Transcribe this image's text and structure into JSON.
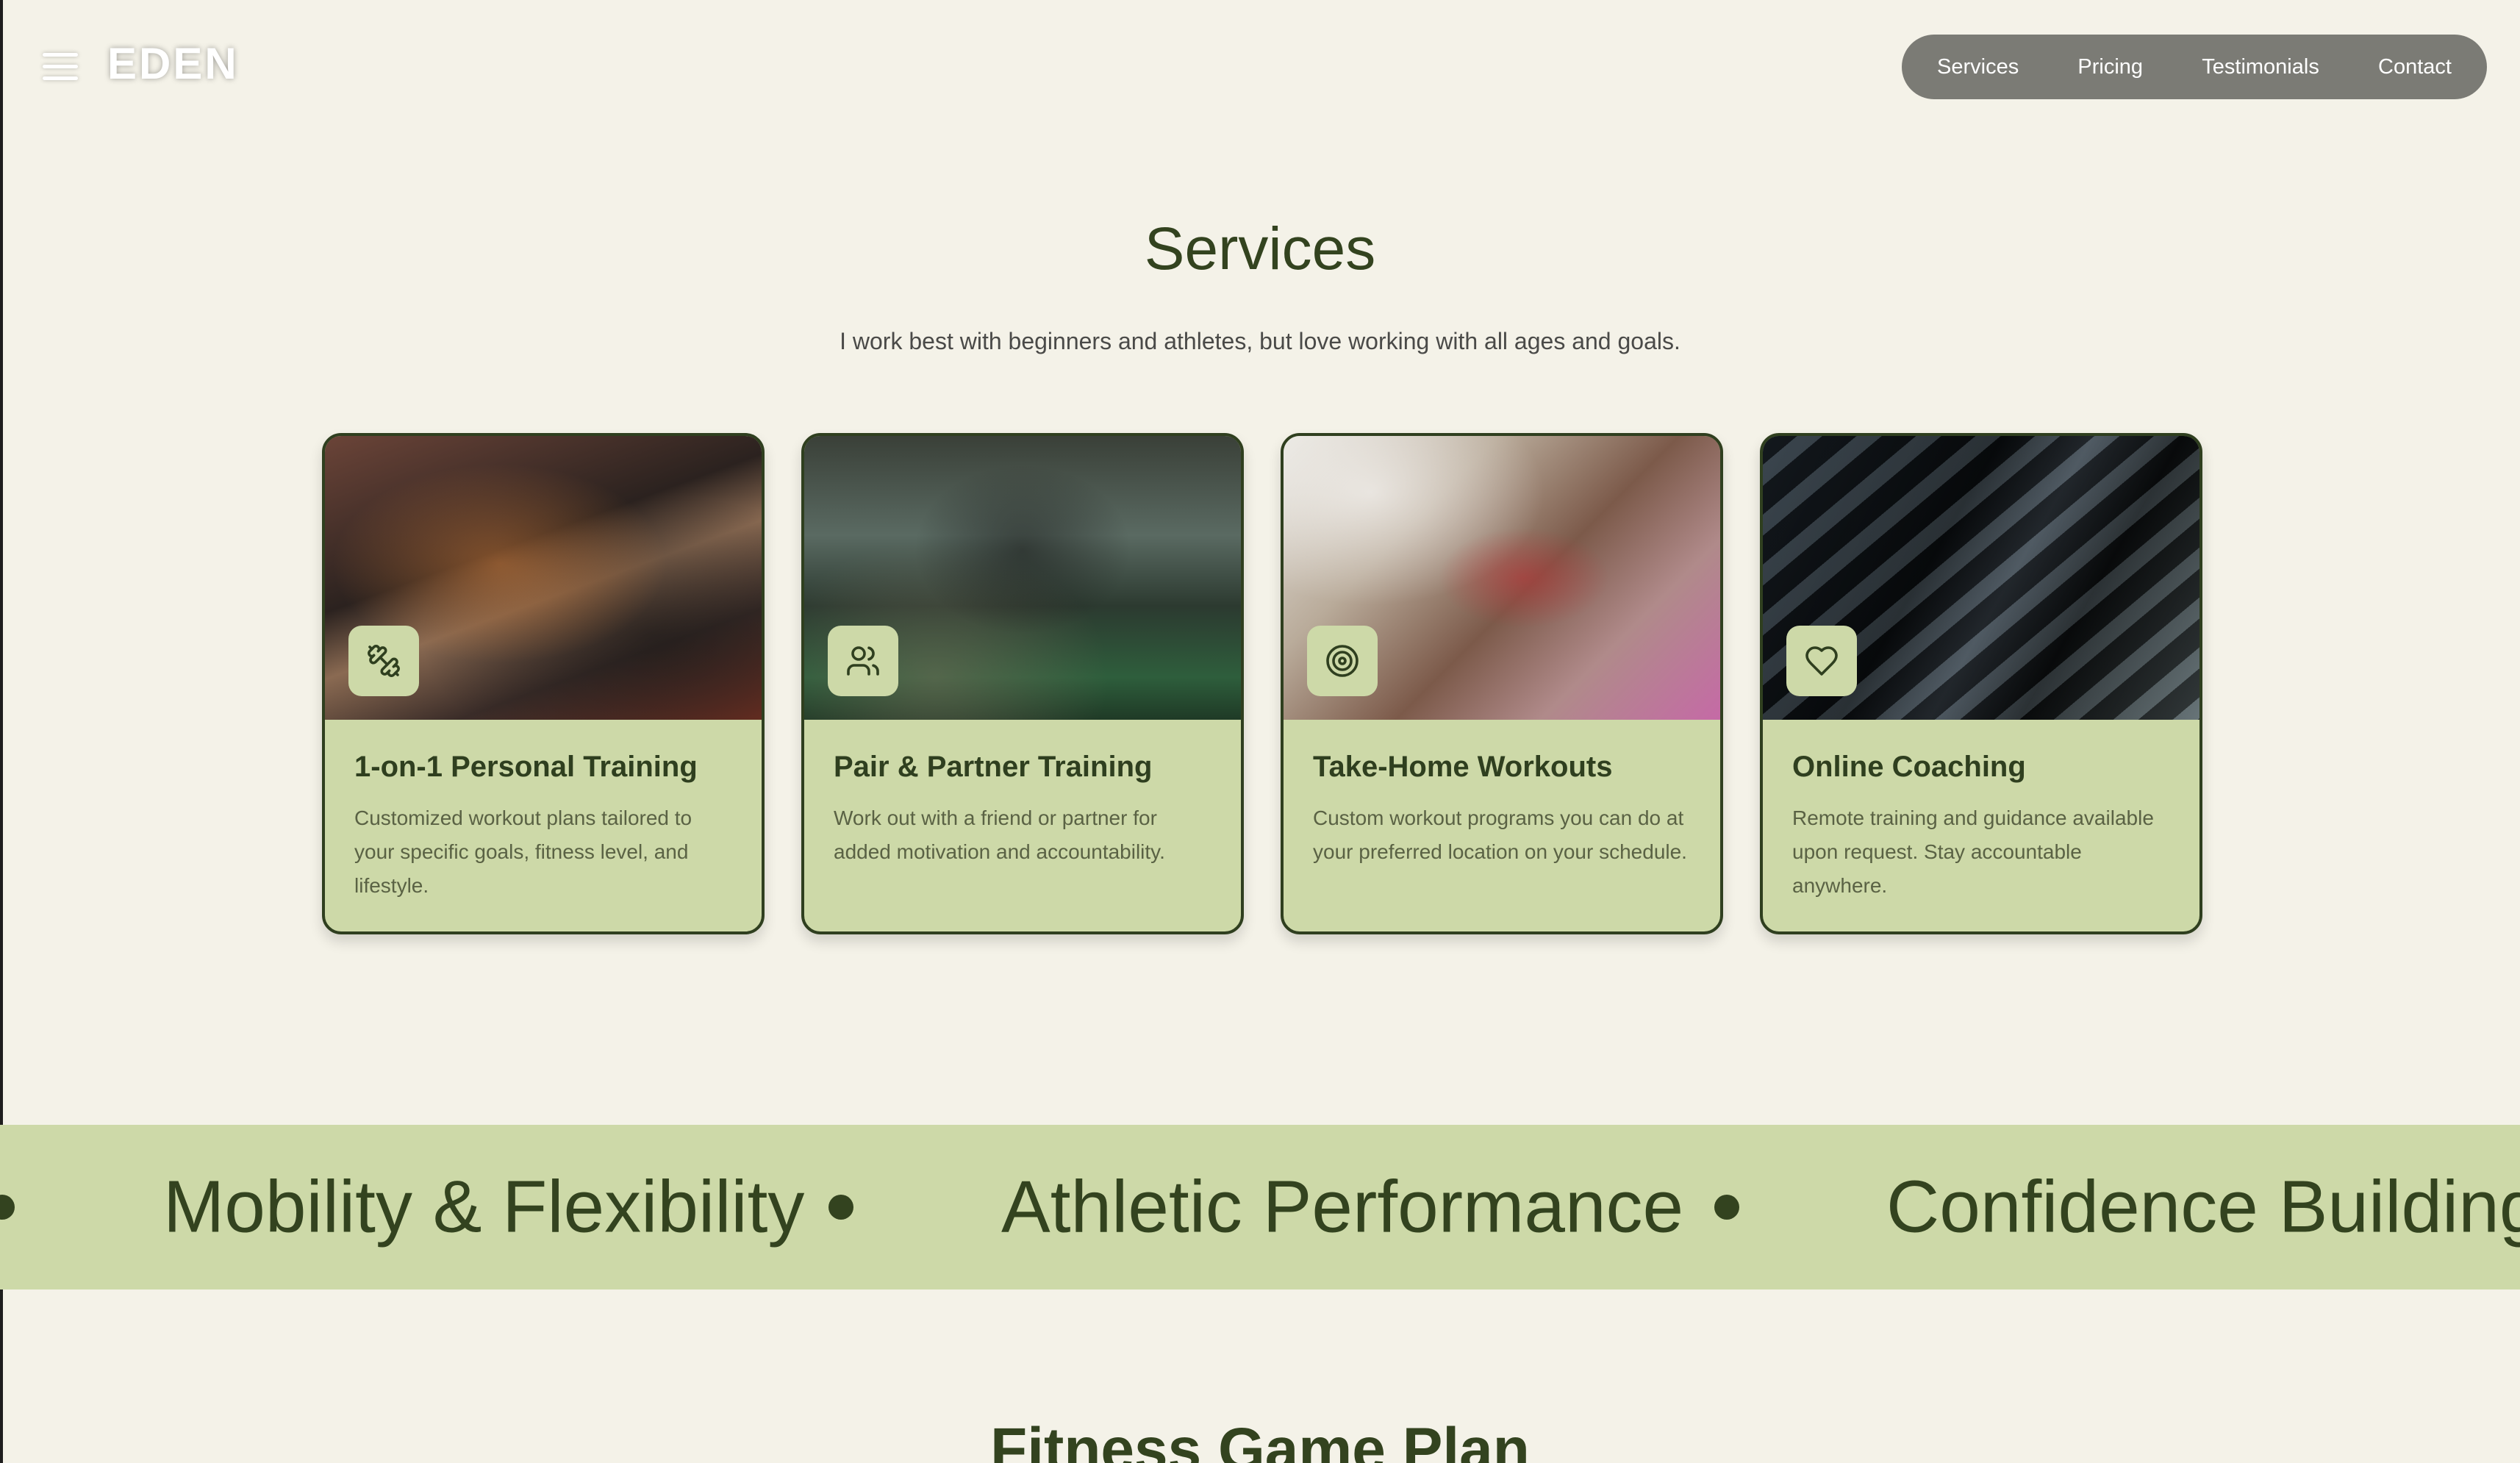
{
  "header": {
    "logo": "EDEN",
    "nav": [
      "Services",
      "Pricing",
      "Testimonials",
      "Contact"
    ]
  },
  "services": {
    "title": "Services",
    "subtitle": "I work best with beginners and athletes, but love working with all ages and goals.",
    "cards": [
      {
        "title": "1-on-1 Personal Training",
        "text": "Customized workout plans tailored to your specific goals, fitness level, and lifestyle.",
        "icon": "dumbbell-icon"
      },
      {
        "title": "Pair & Partner Training",
        "text": "Work out with a friend or partner for added motivation and accountability.",
        "icon": "users-icon"
      },
      {
        "title": "Take-Home Workouts",
        "text": "Custom workout programs you can do at your preferred location on your schedule.",
        "icon": "target-icon"
      },
      {
        "title": "Online Coaching",
        "text": "Remote training and guidance available upon request. Stay accountable anywhere.",
        "icon": "heart-icon"
      }
    ]
  },
  "band": {
    "items": [
      "Mobility & Flexibility",
      "Athletic Performance",
      "Confidence Building"
    ]
  },
  "next_section": {
    "title": "Fitness Game Plan"
  },
  "colors": {
    "background": "#f4f2e8",
    "card": "#cdd9a8",
    "text_dark": "#2f3f1f",
    "nav_pill": "#7b7b75"
  }
}
